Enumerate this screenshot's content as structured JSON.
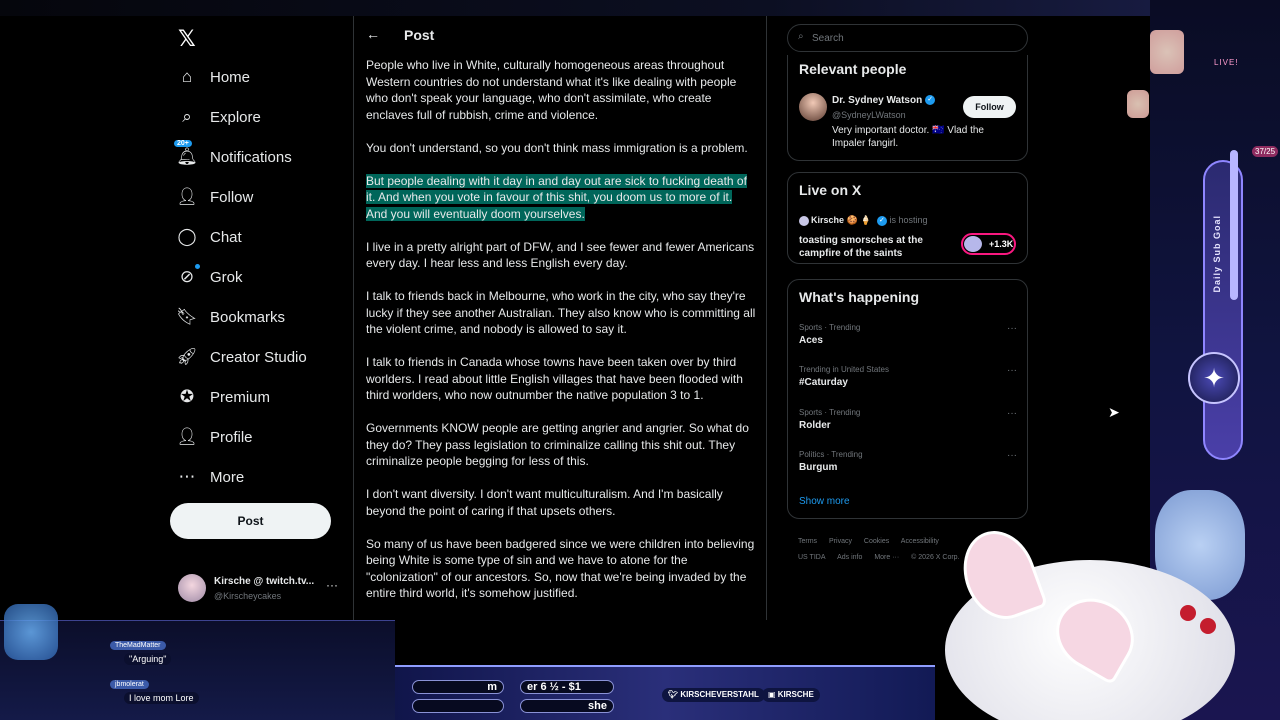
{
  "sidebar": {
    "nav": [
      {
        "label": "Home"
      },
      {
        "label": "Explore"
      },
      {
        "label": "Notifications",
        "badge": "20+"
      },
      {
        "label": "Follow"
      },
      {
        "label": "Chat"
      },
      {
        "label": "Grok"
      },
      {
        "label": "Bookmarks"
      },
      {
        "label": "Creator Studio"
      },
      {
        "label": "Premium"
      },
      {
        "label": "Profile"
      },
      {
        "label": "More"
      }
    ],
    "post_label": "Post",
    "account": {
      "name": "Kirsche @ twitch.tv...",
      "handle": "@Kirscheycakes",
      "more": "···"
    }
  },
  "main": {
    "header_title": "Post",
    "paragraphs": [
      "People who live in White, culturally homogeneous areas throughout Western countries do not understand what it's like dealing with people who don't speak your language, who don't assimilate, who create enclaves full of rubbish, crime and violence.",
      "You don't understand, so you don't think mass immigration is a problem.",
      "But people dealing with it day in and day out are sick to fucking death of it. And when you vote in favour of this shit, you doom us to more of it. And you will eventually doom yourselves.",
      "I live in a pretty alright part of DFW, and I see fewer and fewer Americans every day. I hear less and less English every day.",
      "I talk to friends back in Melbourne, who work in the city, who say they're lucky if they see another Australian. They also know who is committing all the violent crime, and nobody is allowed to say it.",
      "I talk to friends in Canada whose towns have been taken over by third worlders. I read about little English villages that have been flooded with third worlders, who now outnumber the native population 3 to 1.",
      "Governments KNOW people are getting angrier and angrier. So what do they do? They pass legislation to criminalize calling this shit out. They criminalize people begging for less of this.",
      "I don't want diversity. I don't want multiculturalism. And I'm basically beyond the point of caring if that upsets others.",
      "So many of us have been badgered since we were children into believing being White is some type of sin and we have to atone for the \"colonization\" of our ancestors. So, now that we're being invaded by the entire third world, it's somehow justified."
    ]
  },
  "right": {
    "search_placeholder": "Search",
    "relevant_title": "Relevant people",
    "person": {
      "name": "Dr. Sydney Watson",
      "handle": "@SydneyLWatson",
      "bio": "Very important doctor. 🇦🇺 Vlad the Impaler fangirl.",
      "follow_label": "Follow"
    },
    "live_title": "Live on X",
    "live": {
      "host": "Kirsche 🍪 🍦",
      "hosting": "is hosting",
      "text": "toasting smorsches at the campfire of the saints",
      "count": "+1.3K"
    },
    "happening_title": "What's happening",
    "trends": [
      {
        "category": "Sports · Trending",
        "name": "Aces"
      },
      {
        "category": "Trending in United States",
        "name": "#Caturday"
      },
      {
        "category": "Sports · Trending",
        "name": "Rolder"
      },
      {
        "category": "Politics · Trending",
        "name": "Burgum"
      }
    ],
    "show_more": "Show more",
    "footer": [
      "Terms",
      "Privacy",
      "Cookies",
      "Accessibility",
      "US TIDA",
      "Ads info",
      "More ···",
      "© 2026 X Corp."
    ]
  },
  "overlay": {
    "goal_label": "Daily Sub Goal",
    "goal_count": "37/25",
    "live_tag": "LIVE!",
    "chat": [
      {
        "user": "TheMadMatter",
        "message": "\"Arguing\""
      },
      {
        "user": "jbmolerat",
        "message": "I love mom Lore"
      }
    ],
    "ticker_1": "er 6 ½ - $1",
    "ticker_2": "she",
    "ticker_3": "m",
    "socials": [
      "KIRSCHEVERSTAHL",
      "KIRSCHE"
    ]
  }
}
